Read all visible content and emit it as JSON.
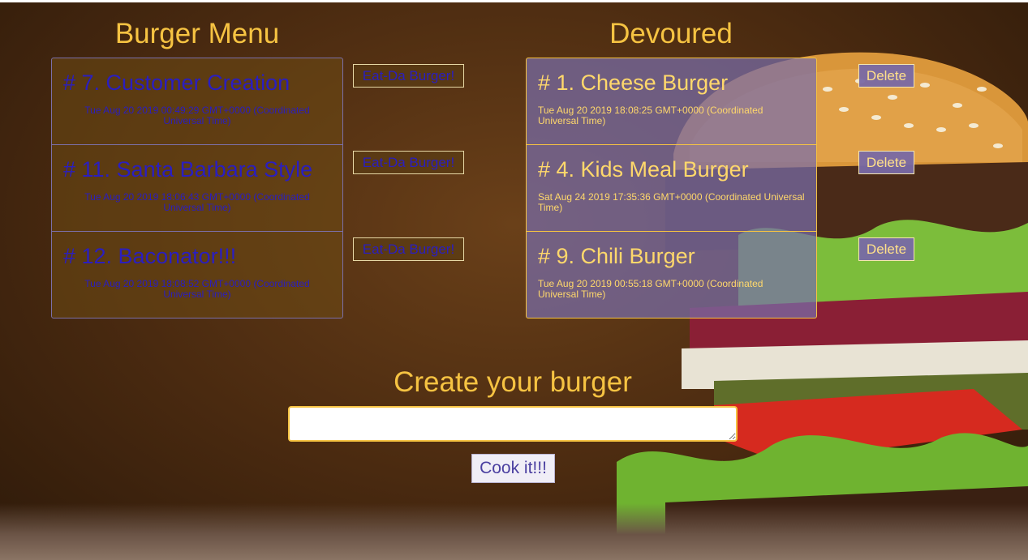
{
  "menu": {
    "heading": "Burger Menu",
    "button_label": "Eat-Da Burger!",
    "items": [
      {
        "title": "# 7. Customer Creation",
        "date": "Tue Aug 20 2019 00:49:29 GMT+0000 (Coordinated Universal Time)"
      },
      {
        "title": "# 11. Santa Barbara Style",
        "date": "Tue Aug 20 2019 18:06:43 GMT+0000 (Coordinated Universal Time)"
      },
      {
        "title": "# 12. Baconator!!!",
        "date": "Tue Aug 20 2019 18:08:52 GMT+0000 (Coordinated Universal Time)"
      }
    ]
  },
  "devoured": {
    "heading": "Devoured",
    "button_label": "Delete",
    "items": [
      {
        "title": "# 1. Cheese Burger",
        "date": "Tue Aug 20 2019 18:08:25 GMT+0000 (Coordinated Universal Time)"
      },
      {
        "title": "# 4. Kids Meal Burger",
        "date": "Sat Aug 24 2019 17:35:36 GMT+0000 (Coordinated Universal Time)"
      },
      {
        "title": "# 9. Chili Burger",
        "date": "Tue Aug 20 2019 00:55:18 GMT+0000 (Coordinated Universal Time)"
      }
    ]
  },
  "create": {
    "heading": "Create your burger",
    "input_value": "",
    "button_label": "Cook it!!!"
  },
  "colors": {
    "accent": "#f6c342",
    "menu_text": "#2a1ec0",
    "devoured_panel": "#7c6eaa"
  },
  "background_image": "burger-photo"
}
